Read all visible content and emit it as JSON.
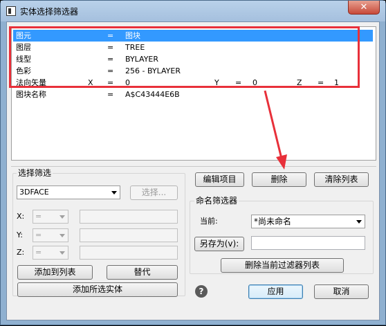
{
  "window": {
    "title": "实体选择筛选器",
    "close_symbol": "✕"
  },
  "filter_list": [
    {
      "name": "图元",
      "eq": "=",
      "value": "图块",
      "selected": true
    },
    {
      "name": "图层",
      "eq": "=",
      "value": "TREE"
    },
    {
      "name": "线型",
      "eq": "=",
      "value": "BYLAYER"
    },
    {
      "name": "色彩",
      "eq": "=",
      "value": "256 - BYLAYER"
    },
    {
      "name": "法向矢量",
      "x_label": "X",
      "x_eq": "=",
      "x_value": "0",
      "y_label": "Y",
      "y_eq": "=",
      "y_value": "0",
      "z_label": "Z",
      "z_eq": "=",
      "z_value": "1"
    },
    {
      "name": "图块名称",
      "eq": "=",
      "value": "A$C43444E6B"
    }
  ],
  "select_filter": {
    "label": "选择筛选",
    "entity_type": "3DFACE",
    "select_button": "选择...",
    "x_label": "X:",
    "y_label": "Y:",
    "z_label": "Z:",
    "operator": "=",
    "add_to_list": "添加到列表",
    "replace": "替代",
    "add_selected": "添加所选实体"
  },
  "actions": {
    "edit_item": "编辑项目",
    "delete": "删除",
    "clear_list": "清除列表"
  },
  "named_filters": {
    "label": "命名筛选器",
    "current_label": "当前:",
    "current_value": "*尚未命名",
    "save_as": "另存为(v):",
    "delete_current": "删除当前过滤器列表"
  },
  "footer": {
    "help_symbol": "?",
    "apply": "应用",
    "cancel": "取消"
  },
  "colors": {
    "selection": "#3399ff",
    "annotation_box": "#e8303a",
    "annotation_arrow": "#e8303a"
  }
}
